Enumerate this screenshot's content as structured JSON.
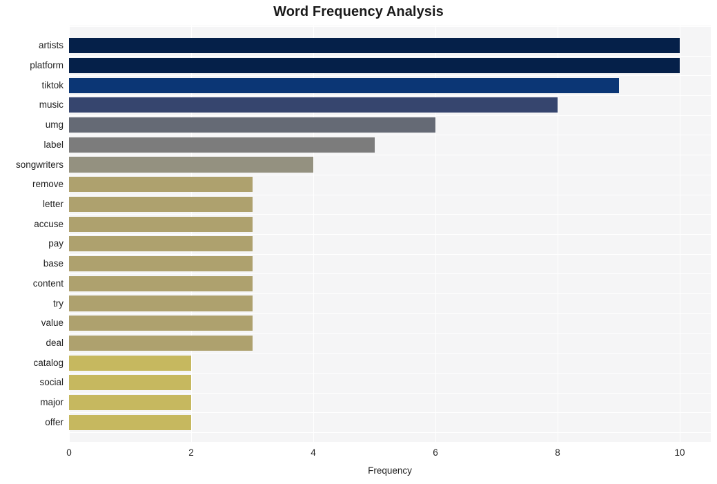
{
  "chart_data": {
    "type": "bar",
    "orientation": "horizontal",
    "title": "Word Frequency Analysis",
    "xlabel": "Frequency",
    "ylabel": "",
    "xlim": [
      0,
      10
    ],
    "xticks": [
      0,
      2,
      4,
      6,
      8,
      10
    ],
    "xtick_labels": [
      "0",
      "2",
      "4",
      "6",
      "8",
      "10"
    ],
    "grid": true,
    "legend": "none",
    "categories": [
      "artists",
      "platform",
      "tiktok",
      "music",
      "umg",
      "label",
      "songwriters",
      "remove",
      "letter",
      "accuse",
      "pay",
      "base",
      "content",
      "try",
      "value",
      "deal",
      "catalog",
      "social",
      "major",
      "offer"
    ],
    "values": [
      10,
      10,
      9,
      8,
      6,
      5,
      4,
      3,
      3,
      3,
      3,
      3,
      3,
      3,
      3,
      3,
      2,
      2,
      2,
      2
    ],
    "bar_colors": [
      "#052049",
      "#052049",
      "#0b3675",
      "#36456e",
      "#656a75",
      "#7c7c7c",
      "#949180",
      "#aea16e",
      "#aea16e",
      "#aea16e",
      "#aea16e",
      "#aea16e",
      "#aea16e",
      "#aea16e",
      "#aea16e",
      "#aea16e",
      "#c6b85f",
      "#c6b85f",
      "#c6b85f",
      "#c6b85f"
    ],
    "plot_bg": "#f5f5f6",
    "grid_color": "#ffffff",
    "figure_bg": "#ffffff"
  }
}
